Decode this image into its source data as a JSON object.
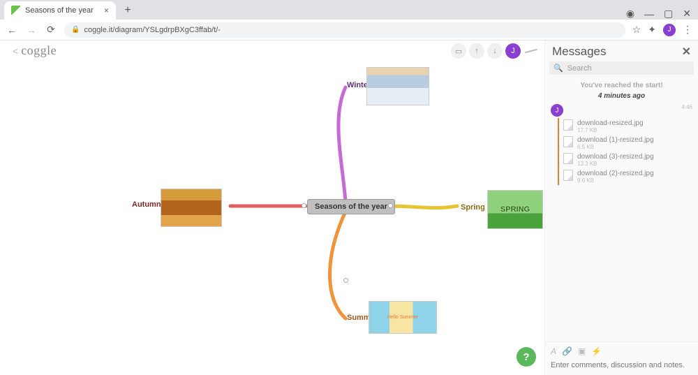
{
  "browser": {
    "tab_title": "Seasons of the year",
    "url": "coggle.it/diagram/YSLgdrpBXgC3ffab/t/-"
  },
  "app": {
    "logo_text": "coggle",
    "avatar_initial": "J"
  },
  "mindmap": {
    "center_label": "Seasons of the year",
    "branches": {
      "winter": {
        "label": "Winter",
        "color": "#c66ad5"
      },
      "spring": {
        "label": "Spring",
        "color": "#e8c334"
      },
      "summer": {
        "label": "Summer",
        "color": "#f0933a"
      },
      "autumn": {
        "label": "Autumn",
        "color": "#e06060"
      }
    },
    "summer_thumb_text": "Hello Summer"
  },
  "sidebar": {
    "title": "Messages",
    "search_placeholder": "Search",
    "start_text": "You've reached the start!",
    "timestamp_label": "4 minutes ago",
    "msg_avatar_initial": "J",
    "msg_time": "4:46",
    "files": [
      {
        "name": "download-resized.jpg",
        "size": "17.7 KB"
      },
      {
        "name": "download (1)-resized.jpg",
        "size": "6.5 KB"
      },
      {
        "name": "download (3)-resized.jpg",
        "size": "13.3 KB"
      },
      {
        "name": "download (2)-resized.jpg",
        "size": "9.6 KB"
      }
    ],
    "comment_placeholder": "Enter comments, discussion and notes."
  },
  "help_fab": "?"
}
